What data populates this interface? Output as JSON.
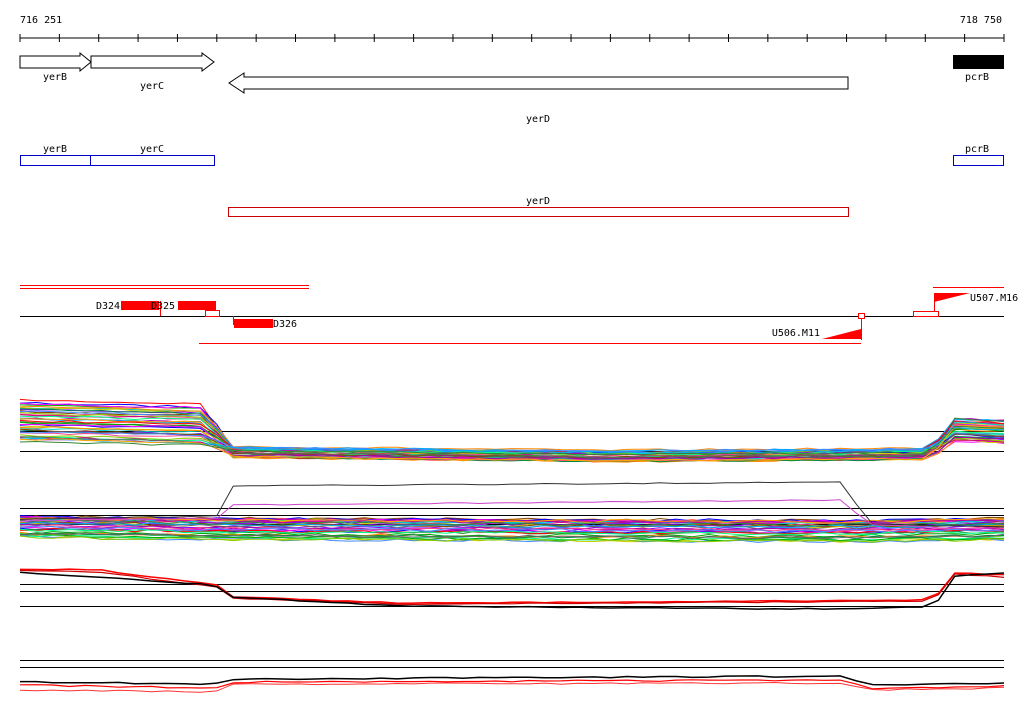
{
  "ruler": {
    "start_label": "716 251",
    "end_label": "718 750"
  },
  "genes": {
    "arrows": [
      {
        "label": "yerB",
        "strand": "+",
        "style": "open"
      },
      {
        "label": "yerC",
        "strand": "+",
        "style": "open"
      },
      {
        "label": "yerD",
        "strand": "-",
        "style": "open"
      },
      {
        "label": "pcrB",
        "strand": "+",
        "style": "filled"
      }
    ],
    "boxes": [
      {
        "label": "yerB",
        "color": "#0000cc"
      },
      {
        "label": "yerC",
        "color": "#0000cc"
      },
      {
        "label": "yerD",
        "color": "#cc0000"
      },
      {
        "label": "pcrB",
        "color": "#0000cc"
      }
    ]
  },
  "features": {
    "blocks": [
      "D324",
      "D325",
      "D326"
    ],
    "markers": [
      "U506.M11",
      "U507.M16"
    ],
    "color": "#ff0000"
  },
  "tracks": [
    {
      "kind": "multicolor"
    },
    {
      "kind": "multicolor"
    },
    {
      "kind": "red-black"
    },
    {
      "kind": "red-black"
    }
  ]
}
